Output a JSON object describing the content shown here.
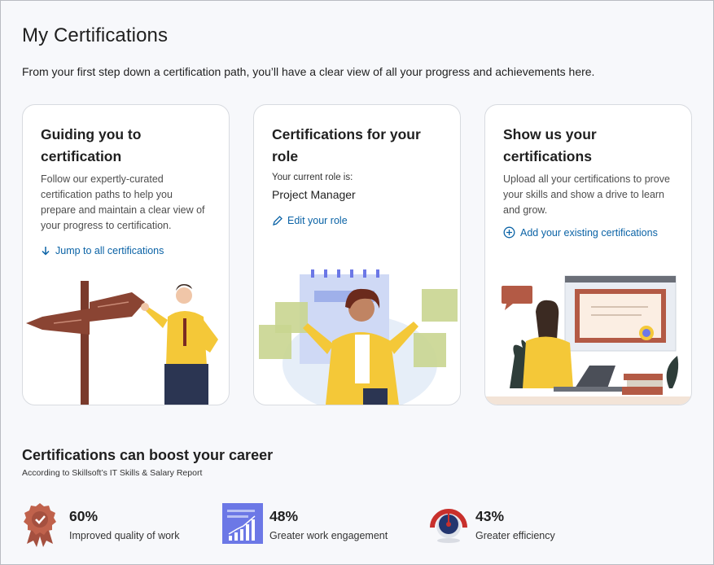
{
  "page": {
    "title": "My Certifications",
    "subtitle": "From your first step down a certification path, you’ll have a clear view of all your progress and achievements here."
  },
  "cards": [
    {
      "title_line1": "Guiding you to",
      "title_line2": "certification",
      "description_lines": [
        "Follow our expertly-curated",
        "certification paths to help you",
        "prepare and maintain a clear view of",
        "your progress to certification."
      ],
      "link": "Jump to all certifications",
      "link_icon": "arrow-down-icon"
    },
    {
      "title_line1": "Certifications for your",
      "title_line2": "role",
      "role_label": "Your current role is:",
      "role_value": "Project Manager",
      "link": "Edit your role",
      "link_icon": "pencil-icon"
    },
    {
      "title_line1": "Show us your",
      "title_line2": "certifications",
      "description_lines": [
        "Upload all your certifications to prove",
        "your skills and show a drive to learn",
        "and grow."
      ],
      "link": "Add your existing certifications",
      "link_icon": "plus-circle-icon"
    }
  ],
  "career": {
    "title": "Certifications can boost your career",
    "source": "According to Skillsoft’s IT Skills & Salary Report",
    "stats": [
      {
        "percent": "60%",
        "label": "Improved quality of work",
        "icon": "award-ribbon-icon"
      },
      {
        "percent": "48%",
        "label": "Greater work engagement",
        "icon": "bar-chart-icon"
      },
      {
        "percent": "43%",
        "label": "Greater efficiency",
        "icon": "gauge-icon"
      }
    ]
  },
  "colors": {
    "link": "#0b63a6",
    "award": "#a5503f",
    "chart_tile": "#6c78e6",
    "gauge_red": "#c8302c",
    "gauge_navy": "#23366f",
    "accent_yellow": "#f4c838"
  }
}
